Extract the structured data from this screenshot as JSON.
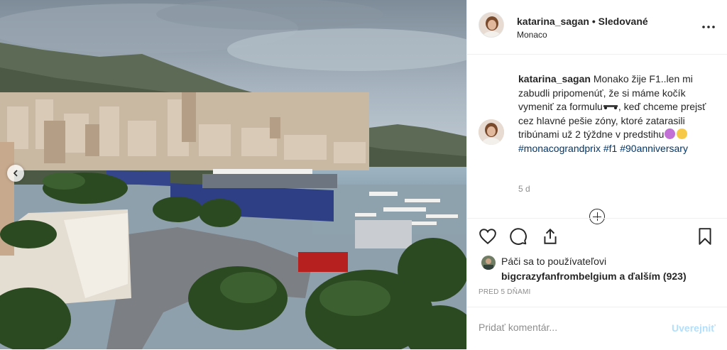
{
  "post": {
    "username": "katarina_sagan",
    "separator": "•",
    "follow_label": "Sledované",
    "location": "Monaco",
    "caption_user": "katarina_sagan",
    "caption_text_1": "Monako žije F1..len mi zabudli pripomenúť, že si máme kočík vymeniť za formulu",
    "caption_text_2": ", keď chceme prejsť cez hlavné pešie zóny, ktoré zatarasili tribúnami už 2 týždne v predstihu",
    "hashtags": [
      "#monacograndprix",
      "#f1",
      "#90anniversary"
    ],
    "age": "5 d",
    "likes_intro": "Páči sa to používateľovi",
    "liked_by": "bigcrazyfanfrombelgium",
    "likes_and": "a ďalším",
    "likes_count": "(923)",
    "timestamp": "PRED 5 DŇAMI"
  },
  "comment": {
    "placeholder": "Pridať komentár...",
    "post_label": "Uverejniť"
  },
  "icons": {
    "like": "heart-icon",
    "comment": "comment-icon",
    "share": "share-icon",
    "save": "bookmark-icon",
    "more": "more-options-icon",
    "prev": "chevron-left-icon"
  },
  "colors": {
    "text": "#262626",
    "secondary": "#8e8e8e",
    "link": "#00376b",
    "post_button": "#b2dffc",
    "border": "#efefef"
  }
}
